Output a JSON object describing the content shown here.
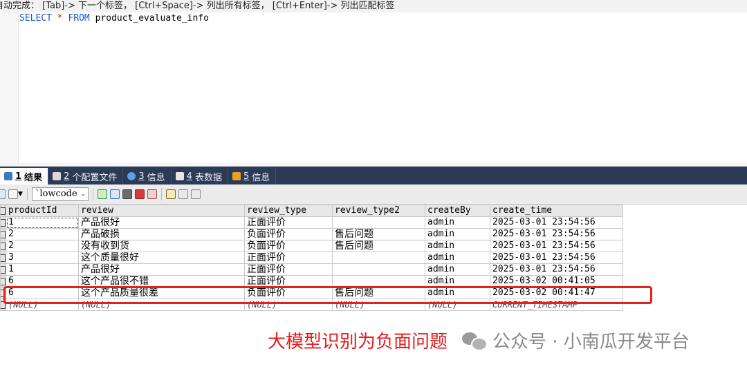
{
  "hint_bar": {
    "text": "自动完成： [Tab]-> 下一个标签， [Ctrl+Space]-> 列出所有标签， [Ctrl+Enter]-> 列出匹配标签"
  },
  "editor": {
    "kw_select": "SELECT",
    "star": "*",
    "kw_from": "FROM",
    "table_name": "product_evaluate_info"
  },
  "result_tabs": [
    {
      "num": "1",
      "label": "结果",
      "icon": "grid-icon"
    },
    {
      "num": "2",
      "label": "个配置文件",
      "icon": "profile-icon"
    },
    {
      "num": "3",
      "label": "信息",
      "icon": "info-icon"
    },
    {
      "num": "4",
      "label": "表数据",
      "icon": "table-data-icon"
    },
    {
      "num": "5",
      "label": "信息",
      "icon": "info-warning-icon"
    }
  ],
  "toolbar": {
    "schema_select_value": "`lowcode"
  },
  "grid": {
    "columns": [
      "productId",
      "review",
      "review_type",
      "review_type2",
      "createBy",
      "create_time"
    ],
    "rows": [
      [
        "1",
        "产品很好",
        "正面评价",
        "",
        "admin",
        "2025-03-01 23:54:56"
      ],
      [
        "2",
        "产品破损",
        "负面评价",
        "售后问题",
        "admin",
        "2025-03-01 23:54:56"
      ],
      [
        "2",
        "没有收到货",
        "负面评价",
        "售后问题",
        "admin",
        "2025-03-01 23:54:56"
      ],
      [
        "3",
        "这个质量很好",
        "正面评价",
        "",
        "admin",
        "2025-03-01 23:54:56"
      ],
      [
        "1",
        "产品很好",
        "正面评价",
        "",
        "admin",
        "2025-03-01 23:54:56"
      ],
      [
        "6",
        "这个产品很不错",
        "正面评价",
        "",
        "admin",
        "2025-03-02 00:41:05"
      ],
      [
        "6",
        "这个产品质量很差",
        "负面评价",
        "售后问题",
        "admin",
        "2025-03-02 00:41:47"
      ],
      [
        "(NULL)",
        "(NULL)",
        "(NULL)",
        "(NULL)",
        "(NULL)",
        "CURRENT_TIMESTAMP"
      ]
    ]
  },
  "annotation": {
    "caption": "大模型识别为负面问题",
    "color": "#e51c1c"
  },
  "watermark": {
    "text": "公众号 · 小南瓜开发平台",
    "icon": "wechat-icon"
  },
  "colors": {
    "tab_bar": "#2b3a55",
    "keyword": "#1e55d6",
    "star": "#dd1111"
  }
}
